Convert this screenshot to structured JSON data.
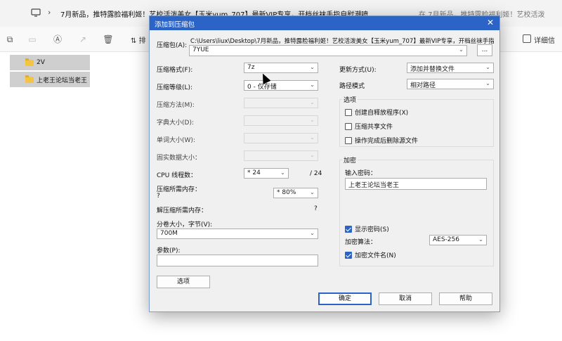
{
  "explorer": {
    "tab_title": "7月新品，推特露脸福利姬！艺校活泼美女【玉米yum_707】最新VIP专享，开档丝袜手指自慰潮喷",
    "search_text": "在 7月新品，推特露脸福利姬！艺校活泼",
    "toolbar": {
      "sort_label": "排",
      "detail_label": "详细信"
    },
    "files": [
      {
        "name": "2V"
      },
      {
        "name": "上老王论坛当老王"
      }
    ]
  },
  "dialog": {
    "title": "添加到压缩包",
    "close_glyph": "✕",
    "archive_label": "压缩包(A):",
    "archive_path": "C:\\Users\\liux\\Desktop\\7月新品，推特露脸福利姬！艺校活泼美女【玉米yum_707】最新VIP专享，开档丝袜手指",
    "archive_value": "7YUE",
    "browse_label": "...",
    "format_label": "压缩格式(F):",
    "format_value": "7z",
    "level_label": "压缩等级(L):",
    "level_value": "0 - 仅存储",
    "method_label": "压缩方法(M):",
    "dict_label": "字典大小(D):",
    "word_label": "单词大小(W):",
    "solid_label": "固实数据大小：",
    "threads_label": "CPU 线程数：",
    "threads_value": "* 24",
    "threads_total": "/ 24",
    "mem_comp_label": "压缩所需内存：",
    "mem_comp_value": "?",
    "mem_percent_value": "* 80%",
    "mem_decomp_label": "解压缩所需内存：",
    "mem_decomp_value": "?",
    "volume_label": "分卷大小，字节(V):",
    "volume_value": "700M",
    "params_label": "参数(P):",
    "params_value": "",
    "options_button": "选项",
    "update_label": "更新方式(U):",
    "update_value": "添加并替换文件",
    "path_label": "路径模式",
    "path_value": "相对路径",
    "options_group": {
      "title": "选项",
      "sfx": "创建自释放程序(X)",
      "shared": "压缩共享文件",
      "delete": "操作完成后删除源文件"
    },
    "encrypt_group": {
      "title": "加密",
      "password_label": "输入密码：",
      "password_value": "上老王论坛当老王",
      "show_password": "显示密码(S)",
      "method_label": "加密算法：",
      "method_value": "AES-256",
      "encrypt_names": "加密文件名(N)"
    },
    "buttons": {
      "ok": "确定",
      "cancel": "取消",
      "help": "帮助"
    }
  }
}
